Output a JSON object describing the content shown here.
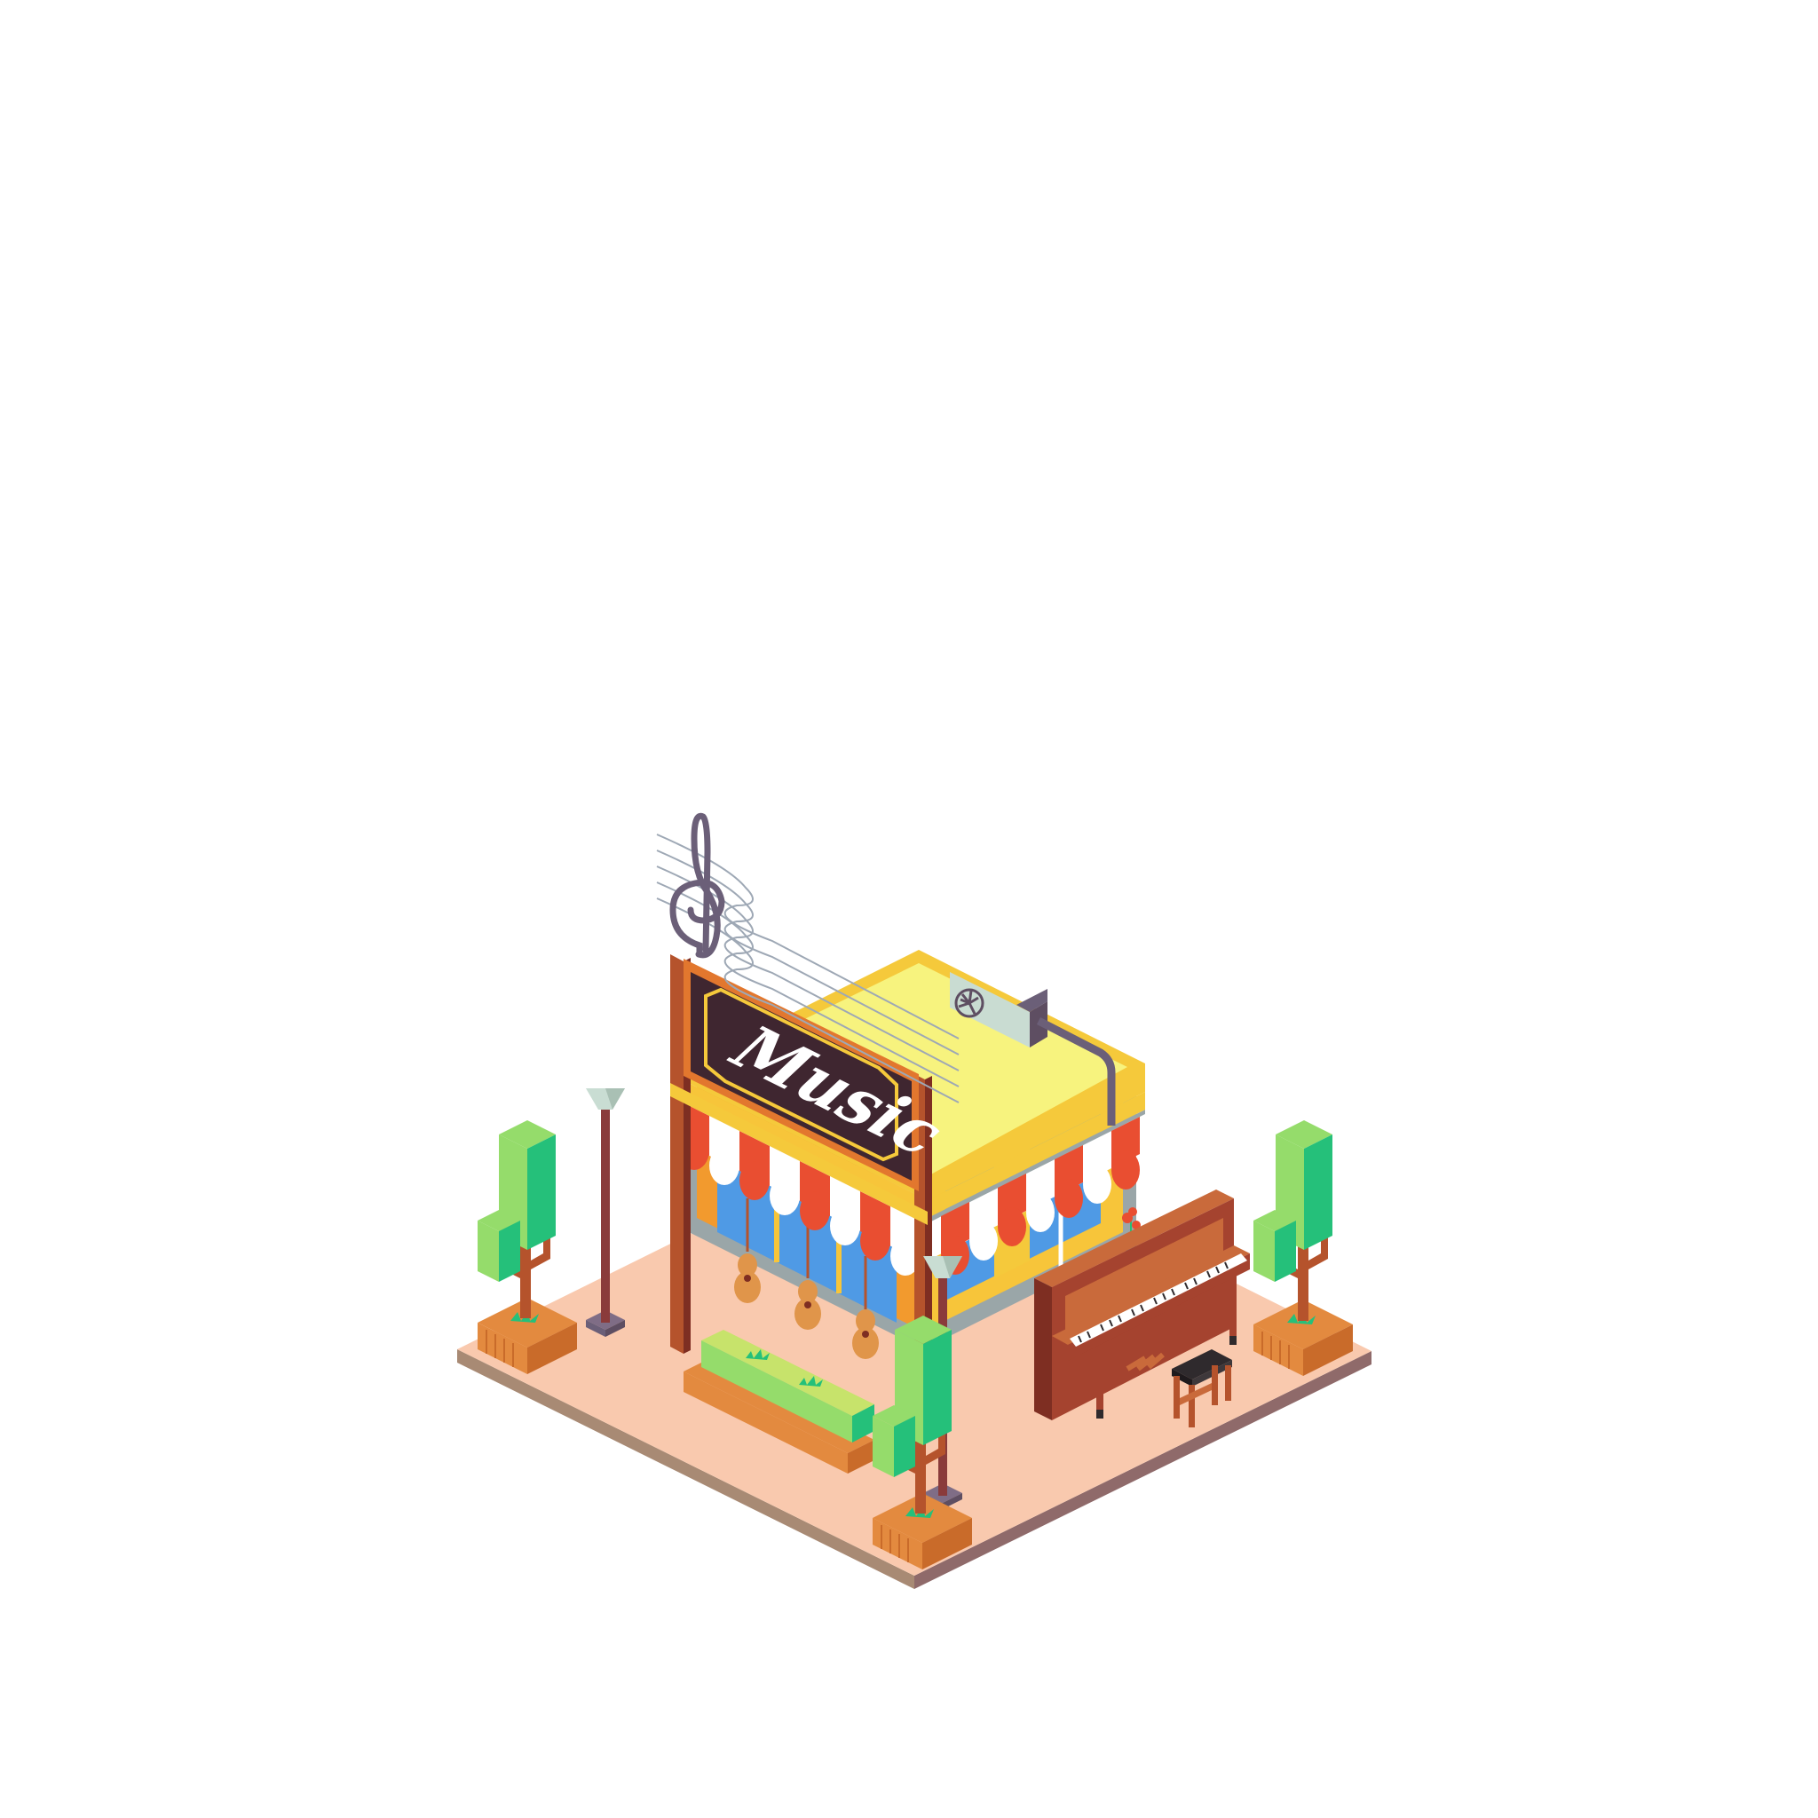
{
  "illustration": {
    "sign_text": "Music",
    "colors": {
      "background": "#ffffff",
      "ground_top": "#f9c9ae",
      "ground_side_left": "#a88a74",
      "ground_side_right": "#8f6a6a",
      "roof_top": "#f7f37e",
      "roof_trim": "#f5c93b",
      "roof_edge": "#9aa6a8",
      "wall_front": "#f7c53a",
      "wall_orange": "#f29a2e",
      "window_glass": "#4f9ae5",
      "awning_red": "#e94e31",
      "awning_white": "#ffffff",
      "sign_frame": "#e2772e",
      "sign_board": "#3f2630",
      "sign_gold": "#f5c93b",
      "clef": "#6b5f78",
      "staff_lines": "#9ea8b5",
      "post_brown": "#b5532c",
      "lamp_pole": "#8a3b3b",
      "lamp_head": "#c9ddd3",
      "tree_light": "#95dc6b",
      "tree_dark": "#25c07a",
      "tree_trunk": "#b5532c",
      "planter": "#e38a3f",
      "planter_dark": "#c96b2a",
      "piano_wood": "#a5432f",
      "piano_dark": "#7e2e22",
      "piano_light": "#c96a3b",
      "piano_keys": "#ffffff",
      "stool_top": "#2f2a2d",
      "guitar": "#e0954a",
      "ac_unit": "#c9dcd2",
      "ac_dark": "#5e4e62"
    },
    "icons": [
      "treble-clef-icon",
      "guitar-icon",
      "fan-icon",
      "flower-icon"
    ]
  }
}
